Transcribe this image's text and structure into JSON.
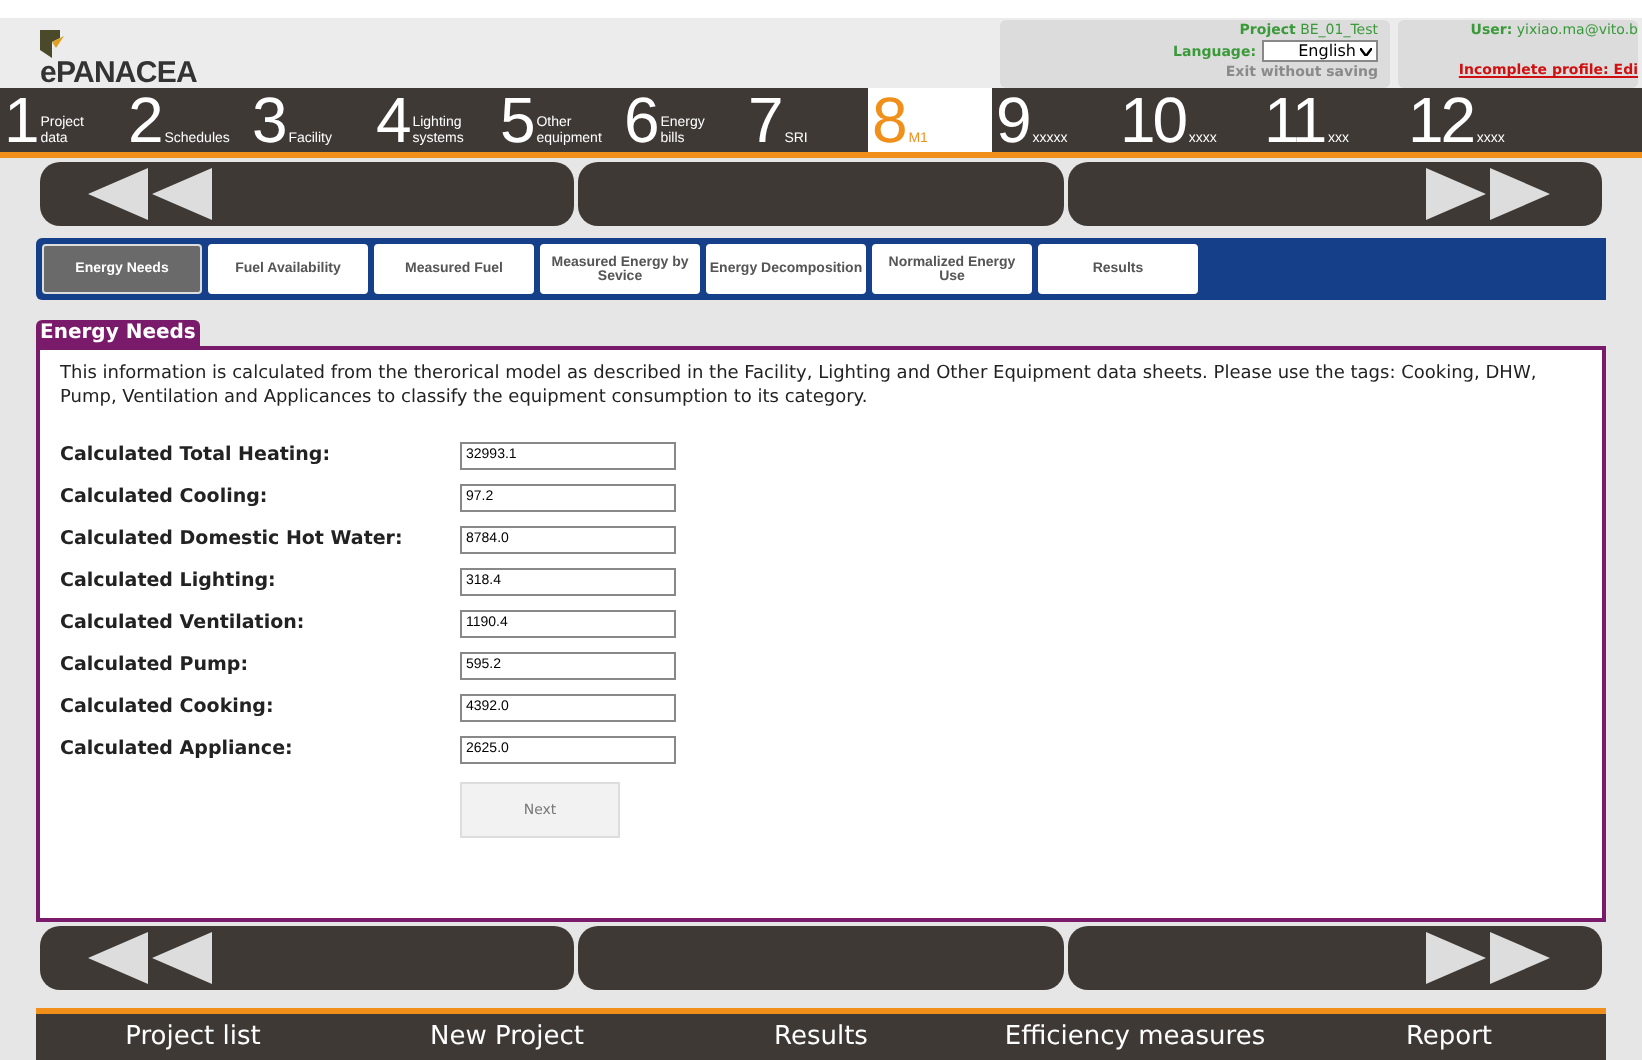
{
  "header": {
    "logo": "ePANACEA",
    "project_label": "Project",
    "project_value": "BE_01_Test",
    "language_label": "Language:",
    "language_value": "English",
    "exit": "Exit without saving",
    "user_label": "User:",
    "user_value": "yixiao.ma@vito.b",
    "profile_warning": "Incomplete profile: Edi"
  },
  "steps": [
    {
      "number": "1",
      "label": "Project data",
      "selected": false
    },
    {
      "number": "2",
      "label": "Schedules",
      "selected": false
    },
    {
      "number": "3",
      "label": "Facility",
      "selected": false
    },
    {
      "number": "4",
      "label": "Lighting systems",
      "selected": false
    },
    {
      "number": "5",
      "label": "Other equipment",
      "selected": false
    },
    {
      "number": "6",
      "label": "Energy bills",
      "selected": false
    },
    {
      "number": "7",
      "label": "SRI",
      "selected": false
    },
    {
      "number": "8",
      "label": "M1",
      "selected": true
    },
    {
      "number": "9",
      "label": "xxxxx",
      "selected": false
    },
    {
      "number": "10",
      "label": "xxxx",
      "selected": false
    },
    {
      "number": "11",
      "label": "xxx",
      "selected": false
    },
    {
      "number": "12",
      "label": "xxxx",
      "selected": false
    }
  ],
  "tabs": [
    {
      "label": "Energy Needs",
      "selected": true
    },
    {
      "label": "Fuel Availability",
      "selected": false
    },
    {
      "label": "Measured Fuel",
      "selected": false
    },
    {
      "label": "Measured Energy by Sevice",
      "selected": false
    },
    {
      "label": "Energy Decomposition",
      "selected": false
    },
    {
      "label": "Normalized Energy Use",
      "selected": false
    },
    {
      "label": "Results",
      "selected": false
    }
  ],
  "panel": {
    "title": "Energy Needs",
    "description": "This information is calculated from the therorical model as described in the Facility, Lighting and Other Equipment data sheets. Please use the tags: Cooking, DHW, Pump, Ventilation and Applicances to classify the equipment consumption to its category.",
    "fields": [
      {
        "label": "Calculated Total Heating:",
        "value": "32993.1"
      },
      {
        "label": "Calculated Cooling:",
        "value": "97.2"
      },
      {
        "label": "Calculated Domestic Hot Water:",
        "value": "8784.0"
      },
      {
        "label": "Calculated Lighting:",
        "value": "318.4"
      },
      {
        "label": "Calculated Ventilation:",
        "value": "1190.4"
      },
      {
        "label": "Calculated Pump:",
        "value": "595.2"
      },
      {
        "label": "Calculated Cooking:",
        "value": "4392.0"
      },
      {
        "label": "Calculated Appliance:",
        "value": "2625.0"
      }
    ],
    "button": "Next"
  },
  "bottom_menu": [
    "Project list",
    "New Project",
    "Results",
    "Efficiency measures",
    "Report"
  ]
}
